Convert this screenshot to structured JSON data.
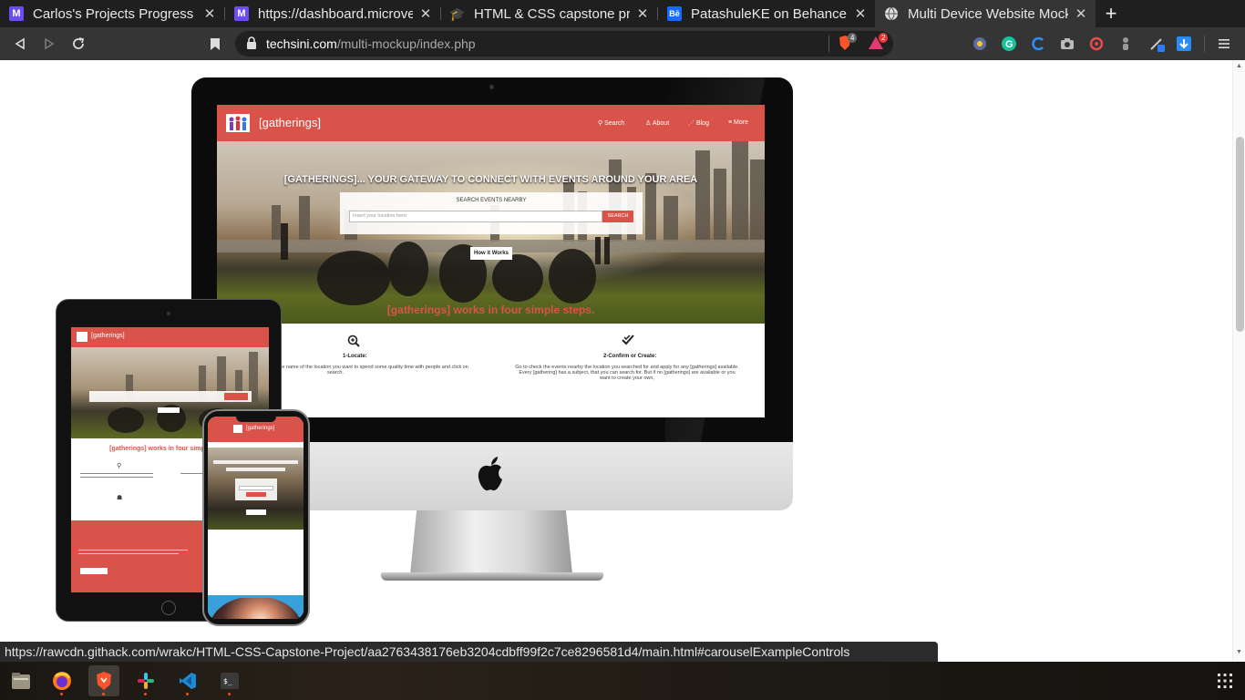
{
  "tabs": [
    {
      "label": "Carlos's Projects Progress",
      "icon": "microverse-icon"
    },
    {
      "label": "https://dashboard.microve",
      "icon": "microverse-icon"
    },
    {
      "label": "HTML & CSS capstone proj",
      "icon": "graduation-cap-icon"
    },
    {
      "label": "PatashuleKE on Behance",
      "icon": "behance-icon",
      "icon_text": "Bē"
    },
    {
      "label": "Multi Device Website Mock",
      "icon": "globe-icon"
    }
  ],
  "address": {
    "host": "techsini.com",
    "path": "/multi-mockup/index.php"
  },
  "extension_badges": {
    "brave": "4",
    "alert": "2"
  },
  "mockup": {
    "brand": "[gatherings]",
    "nav": [
      "Search",
      "About",
      "Blog",
      "More"
    ],
    "headline": "[GATHERINGS]... YOUR GATEWAY TO CONNECT WITH EVENTS AROUND YOUR AREA",
    "search_label": "SEARCH EVENTS NEARBY",
    "search_placeholder": "Insert your location here",
    "search_button": "SEARCH",
    "how_button": "How it Works",
    "steps_title": "[gatherings] works in four simple steps.",
    "step1_title": "1-Locate:",
    "step1_text": "the [gatherings] homepage, enter the name of the location you want to spend some quality time with people and click on search.",
    "step2_title": "2-Confirm or Create:",
    "step2_text": "Go to check the events nearby the location you searched for and apply for any [gatherings] available. Every [gathering] has a subject, that you can search for. But if no [gatherings] are available or you want to create your own,"
  },
  "status_link": "https://rawcdn.githack.com/wrakc/HTML-CSS-Capstone-Project/aa2763438176eb3204cdbff99f2c7ce8296581d4/main.html#carouselExampleControls",
  "colors": {
    "brand_red": "#d9534a",
    "tab_bar": "#1f1f1f",
    "toolbar": "#353535",
    "url_bg": "#202020"
  }
}
